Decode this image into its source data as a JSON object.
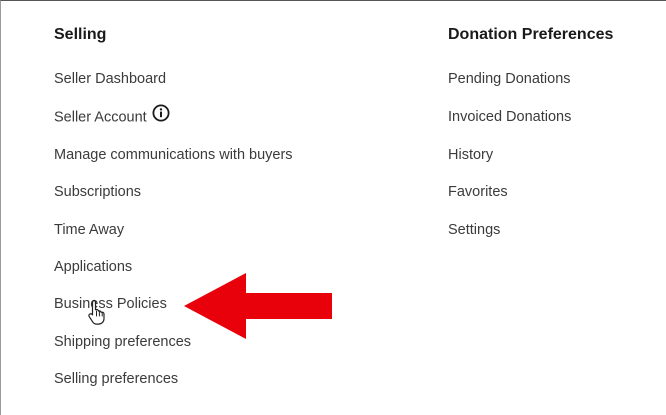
{
  "selling": {
    "heading": "Selling",
    "items": [
      {
        "label": "Seller Dashboard"
      },
      {
        "label": "Seller Account",
        "icon": "info-icon"
      },
      {
        "label": "Manage communications with buyers"
      },
      {
        "label": "Subscriptions"
      },
      {
        "label": "Time Away"
      },
      {
        "label": "Applications"
      },
      {
        "label": "Business Policies"
      },
      {
        "label": "Shipping preferences"
      },
      {
        "label": "Selling preferences"
      }
    ]
  },
  "donation": {
    "heading": "Donation Preferences",
    "items": [
      {
        "label": "Pending Donations"
      },
      {
        "label": "Invoiced Donations"
      },
      {
        "label": "History"
      },
      {
        "label": "Favorites"
      },
      {
        "label": "Settings"
      }
    ]
  },
  "annotation": {
    "arrow_color": "#e8000a",
    "cursor": "hand-pointer-icon"
  }
}
